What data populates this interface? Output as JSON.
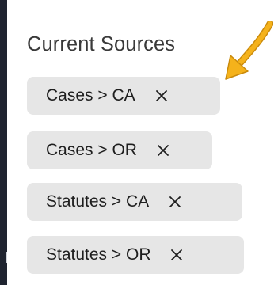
{
  "panel": {
    "title": "Current Sources"
  },
  "annotation": {
    "icon": "arrow-icon",
    "color": "#f5b21b"
  },
  "sources": [
    {
      "label": "Cases > CA",
      "remove_icon": "close-icon"
    },
    {
      "label": "Cases > OR",
      "remove_icon": "close-icon"
    },
    {
      "label": "Statutes > CA",
      "remove_icon": "close-icon"
    },
    {
      "label": "Statutes > OR",
      "remove_icon": "close-icon"
    }
  ],
  "colors": {
    "chip_background": "#e6e6e6",
    "left_bar": "#1f2430",
    "text": "#1e1e1e",
    "heading": "#3a3a3a"
  }
}
